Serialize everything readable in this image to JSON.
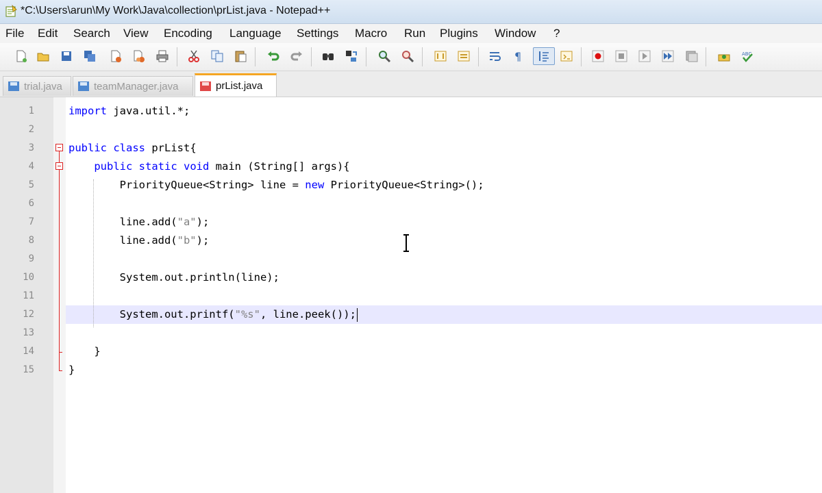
{
  "window": {
    "title": "*C:\\Users\\arun\\My Work\\Java\\collection\\prList.java - Notepad++"
  },
  "menu": [
    "File",
    "Edit",
    "Search",
    "View",
    "Encoding",
    "Language",
    "Settings",
    "Macro",
    "Run",
    "Plugins",
    "Window",
    "?"
  ],
  "toolbar": {
    "icons": [
      "new-file-icon",
      "open-file-icon",
      "save-icon",
      "save-all-icon",
      "close-icon",
      "close-all-icon",
      "print-icon",
      "cut-icon",
      "copy-icon",
      "paste-icon",
      "undo-icon",
      "redo-icon",
      "find-icon",
      "replace-icon",
      "zoom-in-icon",
      "zoom-out-icon",
      "sync-vertical-icon",
      "sync-horizontal-icon",
      "word-wrap-icon",
      "show-all-chars-icon",
      "indent-guide-icon",
      "user-language-icon",
      "record-macro-icon",
      "stop-macro-icon",
      "play-macro-icon",
      "run-macro-multiple-icon",
      "save-macro-icon",
      "plugin-icon",
      "spell-check-icon"
    ],
    "pressed": "indent-guide-icon"
  },
  "tabs": [
    {
      "label": "trial.java",
      "active": false,
      "modified": false
    },
    {
      "label": "teamManager.java",
      "active": false,
      "modified": false
    },
    {
      "label": "prList.java",
      "active": true,
      "modified": true
    }
  ],
  "editor": {
    "current_line": 12,
    "lines": [
      {
        "num": "1",
        "text": "import java.util.*;"
      },
      {
        "num": "2",
        "text": ""
      },
      {
        "num": "3",
        "text": "public class prList{"
      },
      {
        "num": "4",
        "text": "    public static void main (String[] args){"
      },
      {
        "num": "5",
        "text": "        PriorityQueue<String> line = new PriorityQueue<String>();"
      },
      {
        "num": "6",
        "text": ""
      },
      {
        "num": "7",
        "text": "        line.add(\"a\");"
      },
      {
        "num": "8",
        "text": "        line.add(\"b\");"
      },
      {
        "num": "9",
        "text": ""
      },
      {
        "num": "10",
        "text": "        System.out.println(line);"
      },
      {
        "num": "11",
        "text": ""
      },
      {
        "num": "12",
        "text": "        System.out.printf(\"%s\", line.peek());"
      },
      {
        "num": "13",
        "text": ""
      },
      {
        "num": "14",
        "text": "    }"
      },
      {
        "num": "15",
        "text": "}"
      }
    ]
  },
  "colors": {
    "keyword": "#0000ff",
    "string": "#808080",
    "fold_marker": "#dd2222",
    "current_line": "#e8e8ff",
    "active_tab_accent": "#f5a623"
  }
}
